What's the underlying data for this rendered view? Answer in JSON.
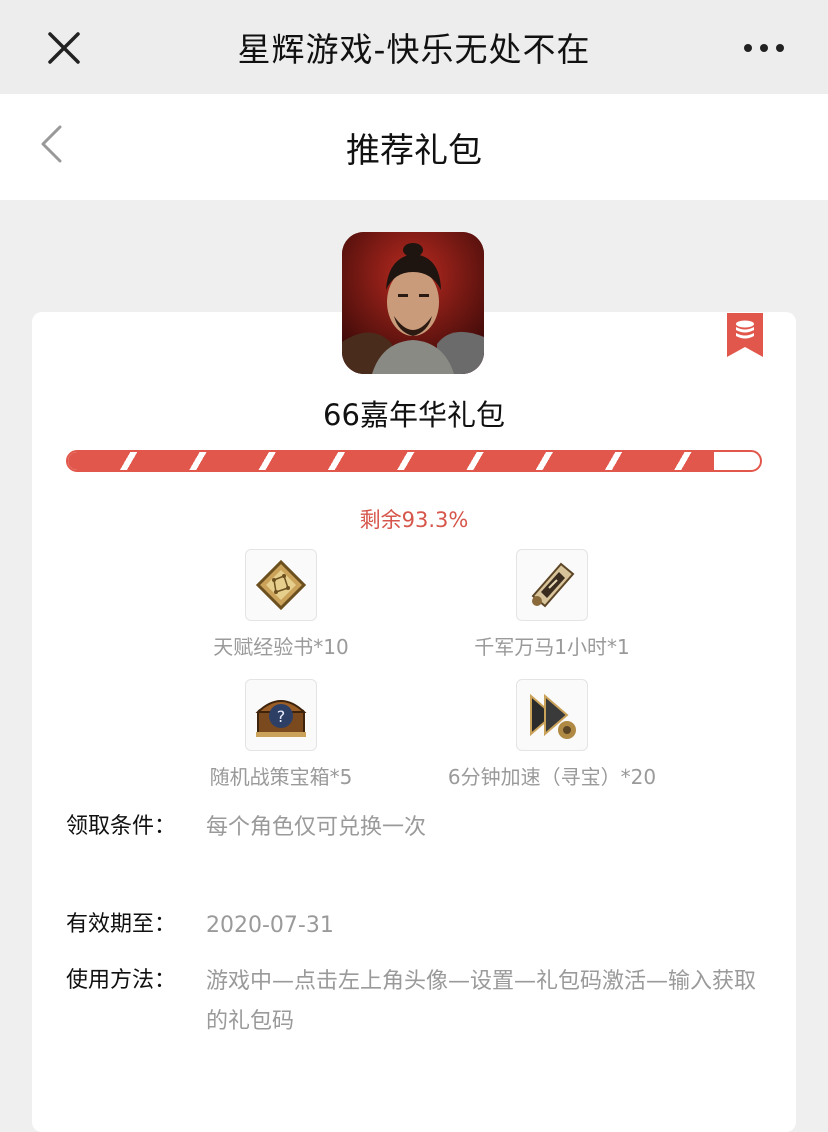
{
  "topbar": {
    "title": "星辉游戏-快乐无处不在"
  },
  "navbar": {
    "title": "推荐礼包"
  },
  "gift": {
    "name": "66嘉年华礼包",
    "remaining_label": "剩余",
    "remaining_value": "93.3%",
    "remaining_fraction": 0.933
  },
  "items": [
    {
      "icon": "skill-map-icon",
      "label": "天赋经验书*10"
    },
    {
      "icon": "scroll-icon",
      "label": "千军万马1小时*1"
    },
    {
      "icon": "treasure-chest-icon",
      "label": "随机战策宝箱*5"
    },
    {
      "icon": "speed-up-icon",
      "label": "6分钟加速（寻宝）*20"
    }
  ],
  "details": {
    "condition_key": "领取条件：",
    "condition_value": "每个角色仅可兑换一次",
    "expiry_key": "有效期至：",
    "expiry_value": "2020-07-31",
    "usage_key": "使用方法：",
    "usage_value": "游戏中—点击左上角头像—设置—礼包码激活—输入获取的礼包码"
  },
  "colors": {
    "accent": "#e2574c",
    "remain_text": "#d6564b",
    "muted_text": "#9a9a9a"
  }
}
